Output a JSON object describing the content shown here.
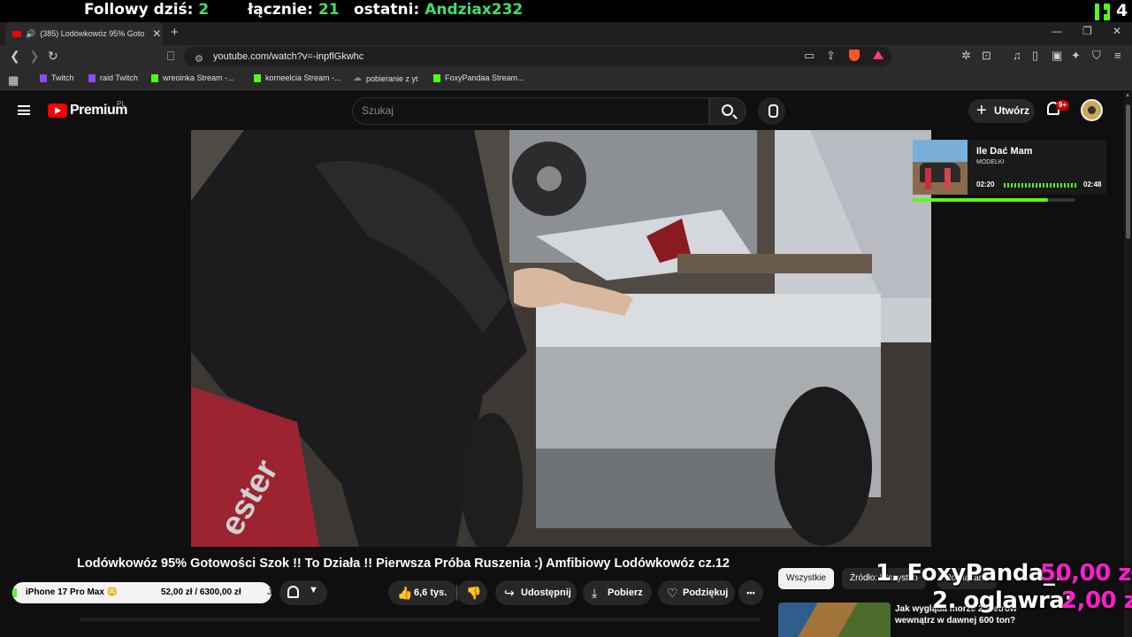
{
  "overlay": {
    "follows_label": "Followy dziś:",
    "follows_value": "2",
    "total_label": "łącznie:",
    "total_value": "21",
    "last_label": "ostatni:",
    "last_value": "Andziax232",
    "kick_count": "4"
  },
  "browser": {
    "tab_title": "(385) Lodówkowóz 95% Gotowości",
    "url": "youtube.com/watch?v=-inpflGkwhc",
    "bookmarks": [
      {
        "label": "Twitch",
        "icon": "twitch"
      },
      {
        "label": "raid Twitch",
        "icon": "twitch"
      },
      {
        "label": "wreoinka Stream -...",
        "icon": "kick"
      },
      {
        "label": "korneelcia Stream -...",
        "icon": "kick"
      },
      {
        "label": "pobieranie z yt",
        "icon": "cloud"
      },
      {
        "label": "FoxyPandaa Stream...",
        "icon": "kick"
      }
    ]
  },
  "youtube": {
    "logo_text": "Premium",
    "region": "PL",
    "search_placeholder": "Szukaj",
    "create_label": "Utwórz",
    "notif_badge": "9+"
  },
  "music_widget": {
    "title": "Ile Dać Mam",
    "artist": "MODELKI",
    "elapsed": "02:20",
    "duration": "02:48",
    "progress": 0.833
  },
  "video": {
    "title": "Lodówkowóz 95% Gotowości Szok !! To Działa !! Pierwsza Próba Ruszenia :) Amfibiowy Lodówkowóz cz.12",
    "like_count": "6,6 tys.",
    "share_label": "Udostępnij",
    "download_label": "Pobierz",
    "thanks_label": "Podziękuj",
    "more_label": "•••"
  },
  "goal": {
    "name": "iPhone 17 Pro Max",
    "emoji": "😳",
    "amount": "52,00 zł  /  6300,00 zł",
    "fraction": 0.008,
    "edge_text": "J"
  },
  "chips": [
    {
      "label": "Wszystkie",
      "active": true
    },
    {
      "label": "Źródło: Wszystko",
      "active": false
    },
    {
      "label": "Powiązane",
      "active": false
    }
  ],
  "recommendation": {
    "title": "Jak wygląda morze 2 metrów wewnątrz w dawnej 600 ton?"
  },
  "donations": [
    {
      "name": "1. FoxyPanda_:",
      "amount": "50,00 zł"
    },
    {
      "name": "2. oglawra:",
      "amount": "2,00 zł"
    }
  ]
}
